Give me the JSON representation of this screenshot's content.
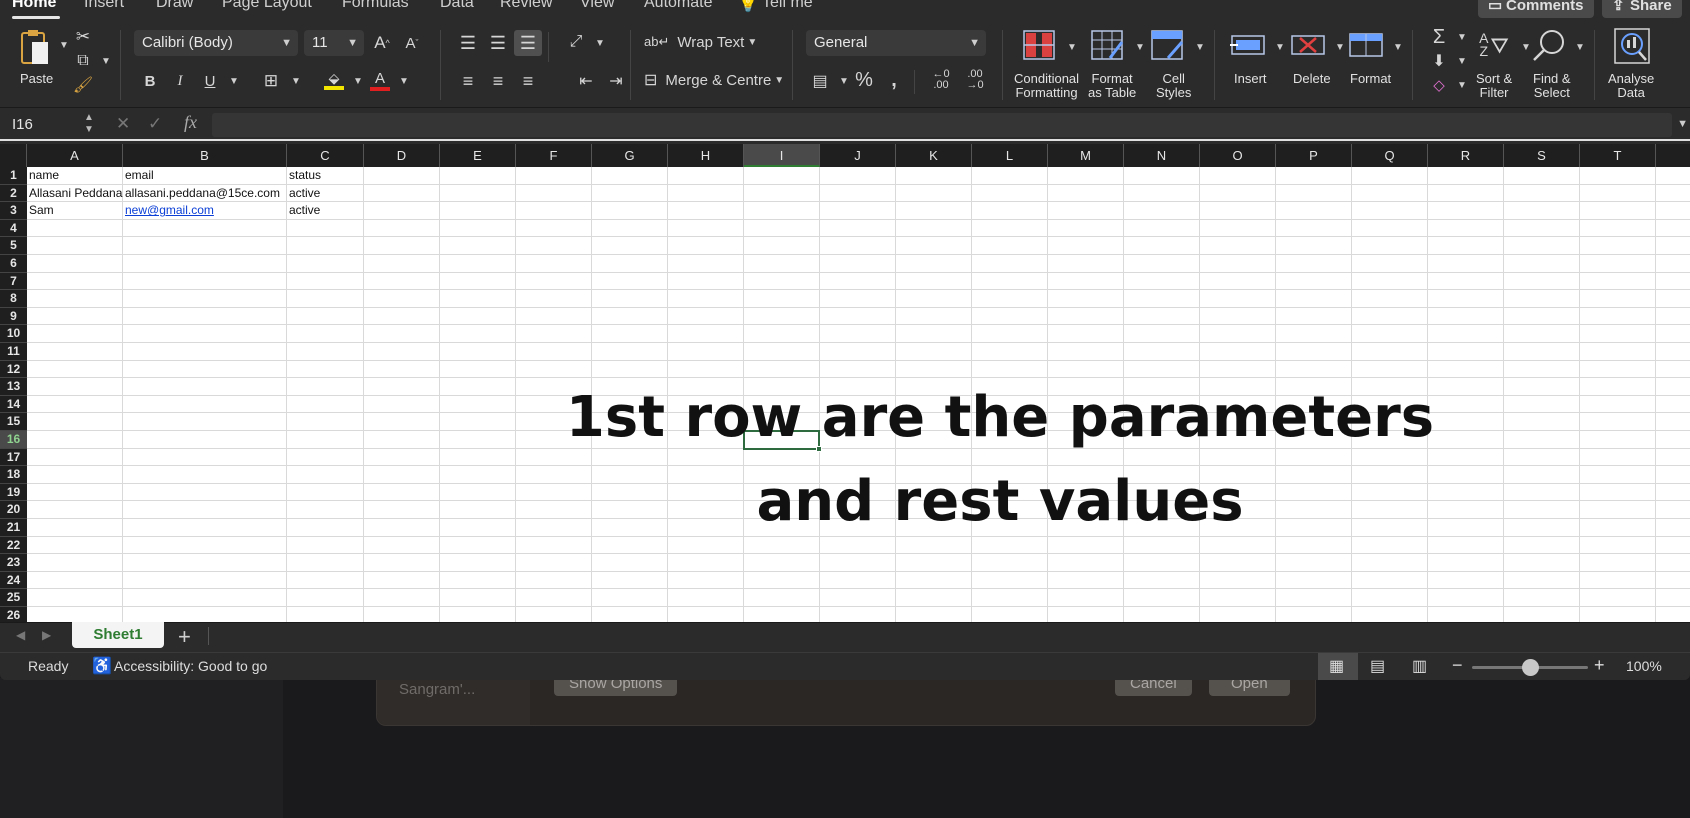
{
  "ribbon_tabs": [
    "Home",
    "Insert",
    "Draw",
    "Page Layout",
    "Formulas",
    "Data",
    "Review",
    "View",
    "Automate",
    "Tell me"
  ],
  "top_right": {
    "comments": "Comments",
    "share": "Share"
  },
  "clipboard": {
    "paste": "Paste"
  },
  "font": {
    "name": "Calibri (Body)",
    "size": "11"
  },
  "alignment": {
    "wrap_text": "Wrap Text",
    "merge_centre": "Merge & Centre"
  },
  "number": {
    "format": "General"
  },
  "styles": {
    "conditional_formatting": [
      "Conditional",
      "Formatting"
    ],
    "format_as_table": [
      "Format",
      "as Table"
    ],
    "cell_styles": [
      "Cell",
      "Styles"
    ]
  },
  "cells_group": {
    "insert": "Insert",
    "delete": "Delete",
    "format": "Format"
  },
  "editing": {
    "sort_filter": [
      "Sort &",
      "Filter"
    ],
    "find_select": [
      "Find &",
      "Select"
    ]
  },
  "analysis": {
    "analyse_data": [
      "Analyse",
      "Data"
    ]
  },
  "formula_bar": {
    "name_box": "I16",
    "fx": "fx"
  },
  "columns": [
    "A",
    "B",
    "C",
    "D",
    "E",
    "F",
    "G",
    "H",
    "I",
    "J",
    "K",
    "L",
    "M",
    "N",
    "O",
    "P",
    "Q",
    "R",
    "S",
    "T"
  ],
  "selected_column": "I",
  "rows": [
    "1",
    "2",
    "3",
    "4",
    "5",
    "6",
    "7",
    "8",
    "9",
    "10",
    "11",
    "12",
    "13",
    "14",
    "15",
    "16",
    "17",
    "18",
    "19",
    "20",
    "21",
    "22",
    "23",
    "24",
    "25",
    "26"
  ],
  "selected_row": "16",
  "sheet_cells": [
    [
      "name",
      "email",
      "status"
    ],
    [
      "Allasani Peddana",
      "allasani.peddana@15ce.com",
      "active"
    ],
    [
      "Sam",
      "new@gmail.com",
      "active"
    ]
  ],
  "overlay_text": [
    "1st row are the parameters",
    "and rest values"
  ],
  "sheet_tab": "Sheet1",
  "status": {
    "ready": "Ready",
    "accessibility": "Accessibility: Good to go",
    "zoom": "100%",
    "zoom_level": 0.5
  },
  "background_dialog": {
    "side_label": "Sangram'...",
    "show_options": "Show Options",
    "cancel": "Cancel",
    "open": "Open"
  }
}
